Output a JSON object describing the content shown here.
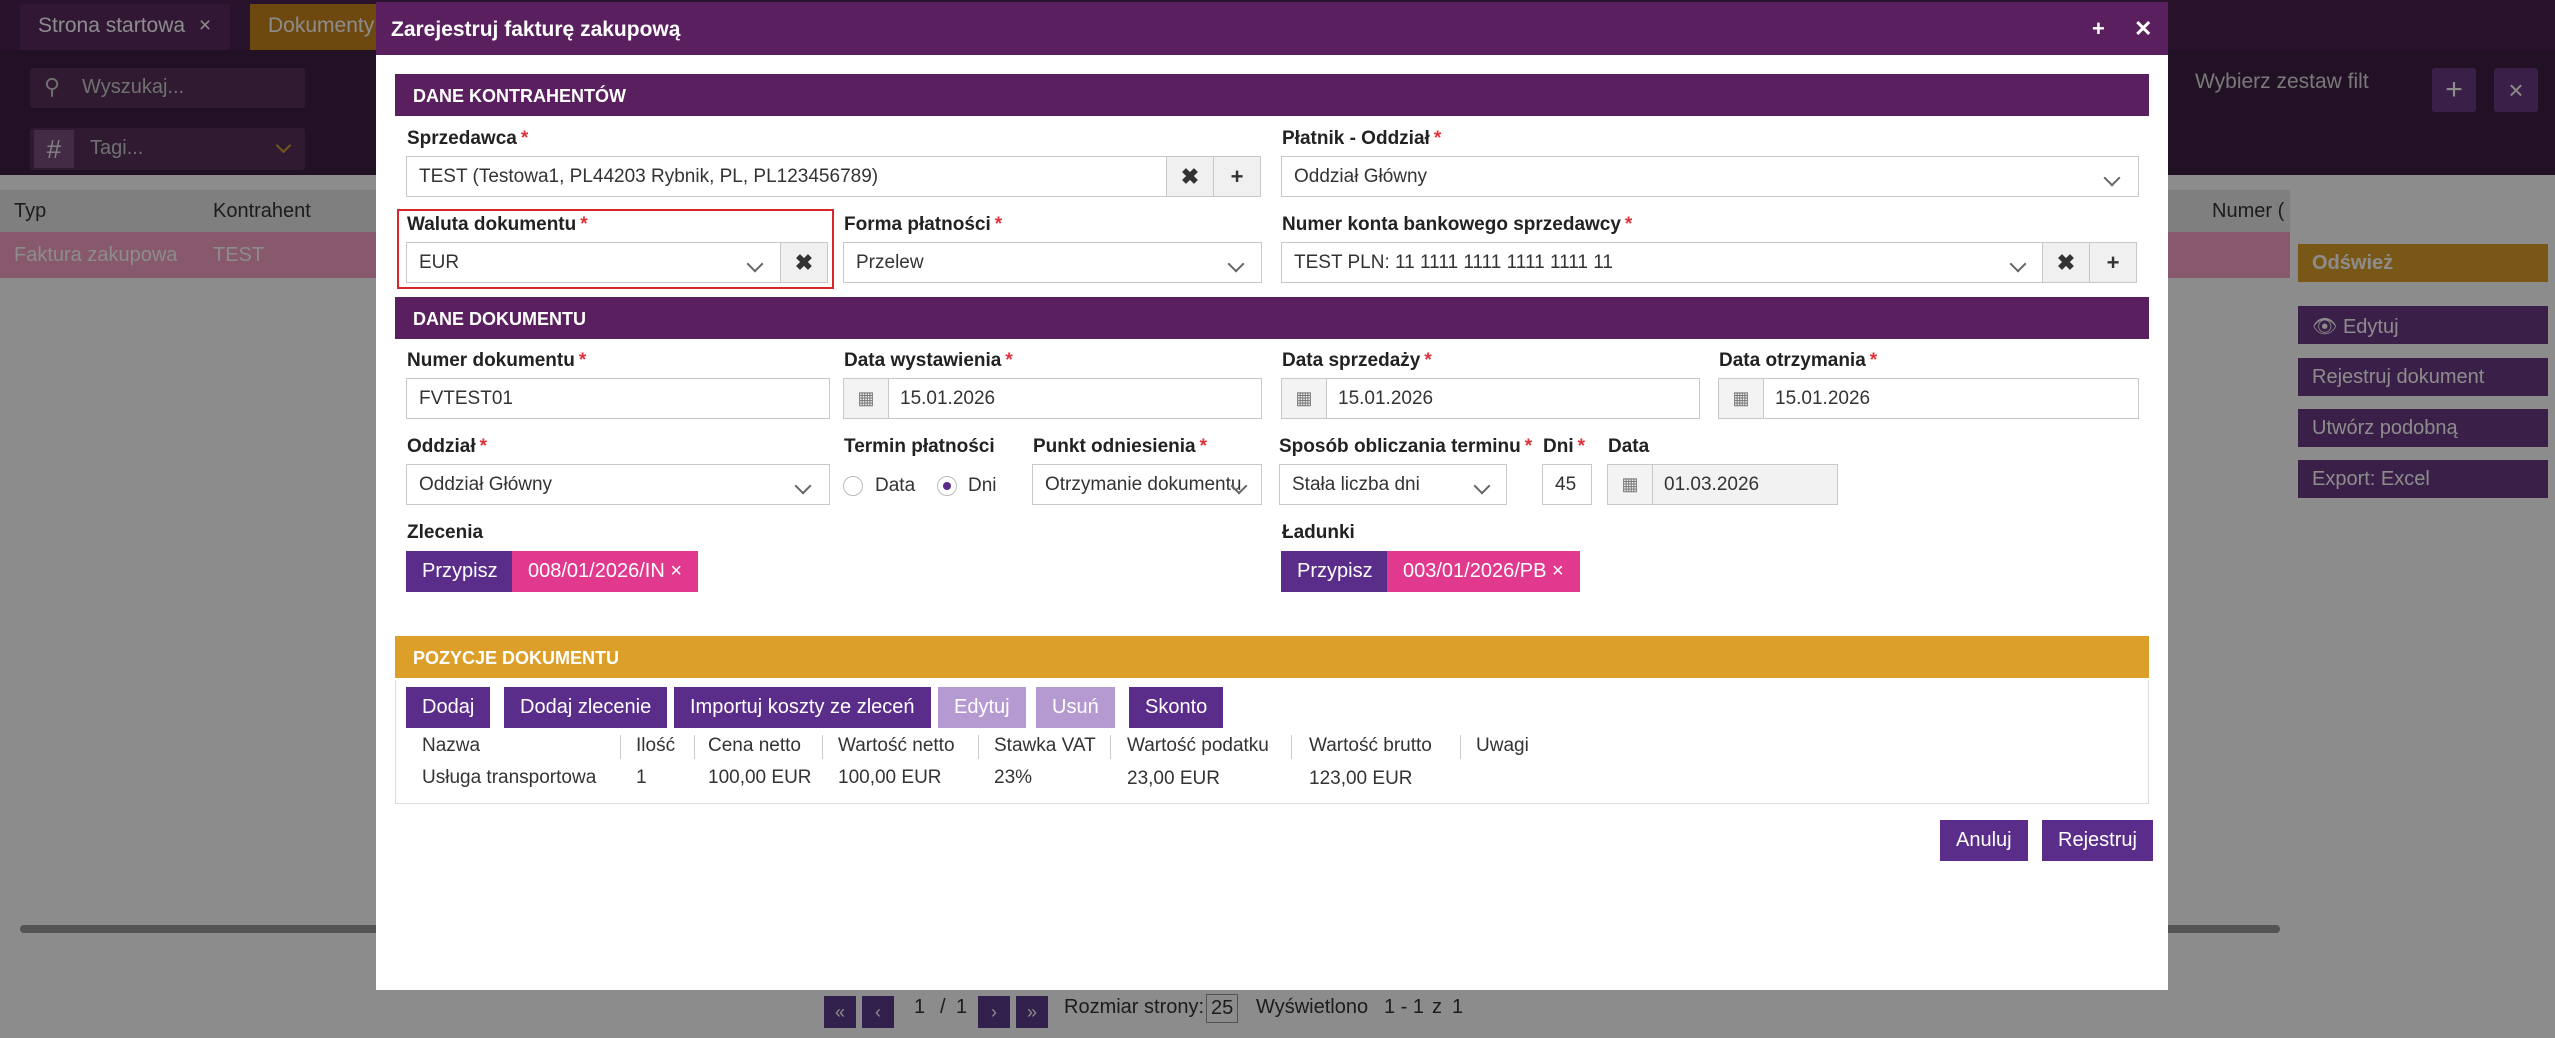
{
  "background": {
    "tabs": [
      {
        "label": "Strona startowa",
        "close": "×"
      },
      {
        "label": "Dokumenty"
      }
    ],
    "search_placeholder": "Wyszukaj...",
    "tags_placeholder": "Tagi...",
    "filter_set": "Wybierz zestaw filt",
    "grid_columns": [
      "Typ",
      "Kontrahent",
      "Numer ("
    ],
    "grid_row": {
      "typ": "Faktura zakupowa",
      "kontrahent": "TEST"
    },
    "side_buttons": [
      "Odśwież",
      "Edytuj",
      "Rejestruj dokument",
      "Utwórz podobną",
      "Export: Excel"
    ],
    "pager": {
      "current": "1",
      "separator": "/",
      "total": "1",
      "page_size_label": "Rozmiar strony:",
      "page_size": "25",
      "shown_label": "Wyświetlono",
      "range": "1 - 1",
      "of": "z",
      "count": "1"
    }
  },
  "modal": {
    "title": "Zarejestruj fakturę zakupową",
    "section_parties": "DANE KONTRAHENTÓW",
    "seller_label": "Sprzedawca",
    "seller_value": "TEST (Testowa1, PL44203 Rybnik, PL, PL123456789)",
    "payer_label": "Płatnik - Oddział",
    "payer_value": "Oddział Główny",
    "currency_label": "Waluta dokumentu",
    "currency_value": "EUR",
    "payment_form_label": "Forma płatności",
    "payment_form_value": "Przelew",
    "bank_account_label": "Numer konta bankowego sprzedawcy",
    "bank_account_value": "TEST PLN: 11 1111 1111 1111 1111 11",
    "section_document": "DANE DOKUMENTU",
    "doc_number_label": "Numer dokumentu",
    "doc_number_value": "FVTEST01",
    "issue_date_label": "Data wystawienia",
    "issue_date_value": "15.01.2026",
    "sale_date_label": "Data sprzedaży",
    "sale_date_value": "15.01.2026",
    "receipt_date_label": "Data otrzymania",
    "receipt_date_value": "15.01.2026",
    "branch_label": "Oddział",
    "branch_value": "Oddział Główny",
    "payment_term_label": "Termin płatności",
    "term_option_date": "Data",
    "term_option_days": "Dni",
    "reference_point_label": "Punkt odniesienia",
    "reference_point_value": "Otrzymanie dokumentu",
    "calc_method_label": "Sposób obliczania terminu",
    "calc_method_value": "Stała liczba dni",
    "days_label": "Dni",
    "days_value": "45",
    "due_date_label": "Data",
    "due_date_value": "01.03.2026",
    "orders_label": "Zlecenia",
    "orders_assign": "Przypisz",
    "orders_chip": "008/01/2026/IN ×",
    "loads_label": "Ładunki",
    "loads_assign": "Przypisz",
    "loads_chip": "003/01/2026/PB ×",
    "section_items": "POZYCJE DOKUMENTU",
    "item_buttons": {
      "add": "Dodaj",
      "add_order": "Dodaj zlecenie",
      "import_costs": "Importuj koszty ze zleceń",
      "edit": "Edytuj",
      "remove": "Usuń",
      "discount": "Skonto"
    },
    "table_columns": [
      "Nazwa",
      "Ilość",
      "Cena netto",
      "Wartość netto",
      "Stawka VAT",
      "Wartość podatku",
      "Wartość brutto",
      "Uwagi"
    ],
    "table_rows": [
      [
        "Usługa transportowa",
        "1",
        "100,00 EUR",
        "100,00 EUR",
        "23%",
        "23,00 EUR",
        "123,00 EUR",
        ""
      ]
    ],
    "cancel": "Anuluj",
    "register": "Rejestruj"
  }
}
